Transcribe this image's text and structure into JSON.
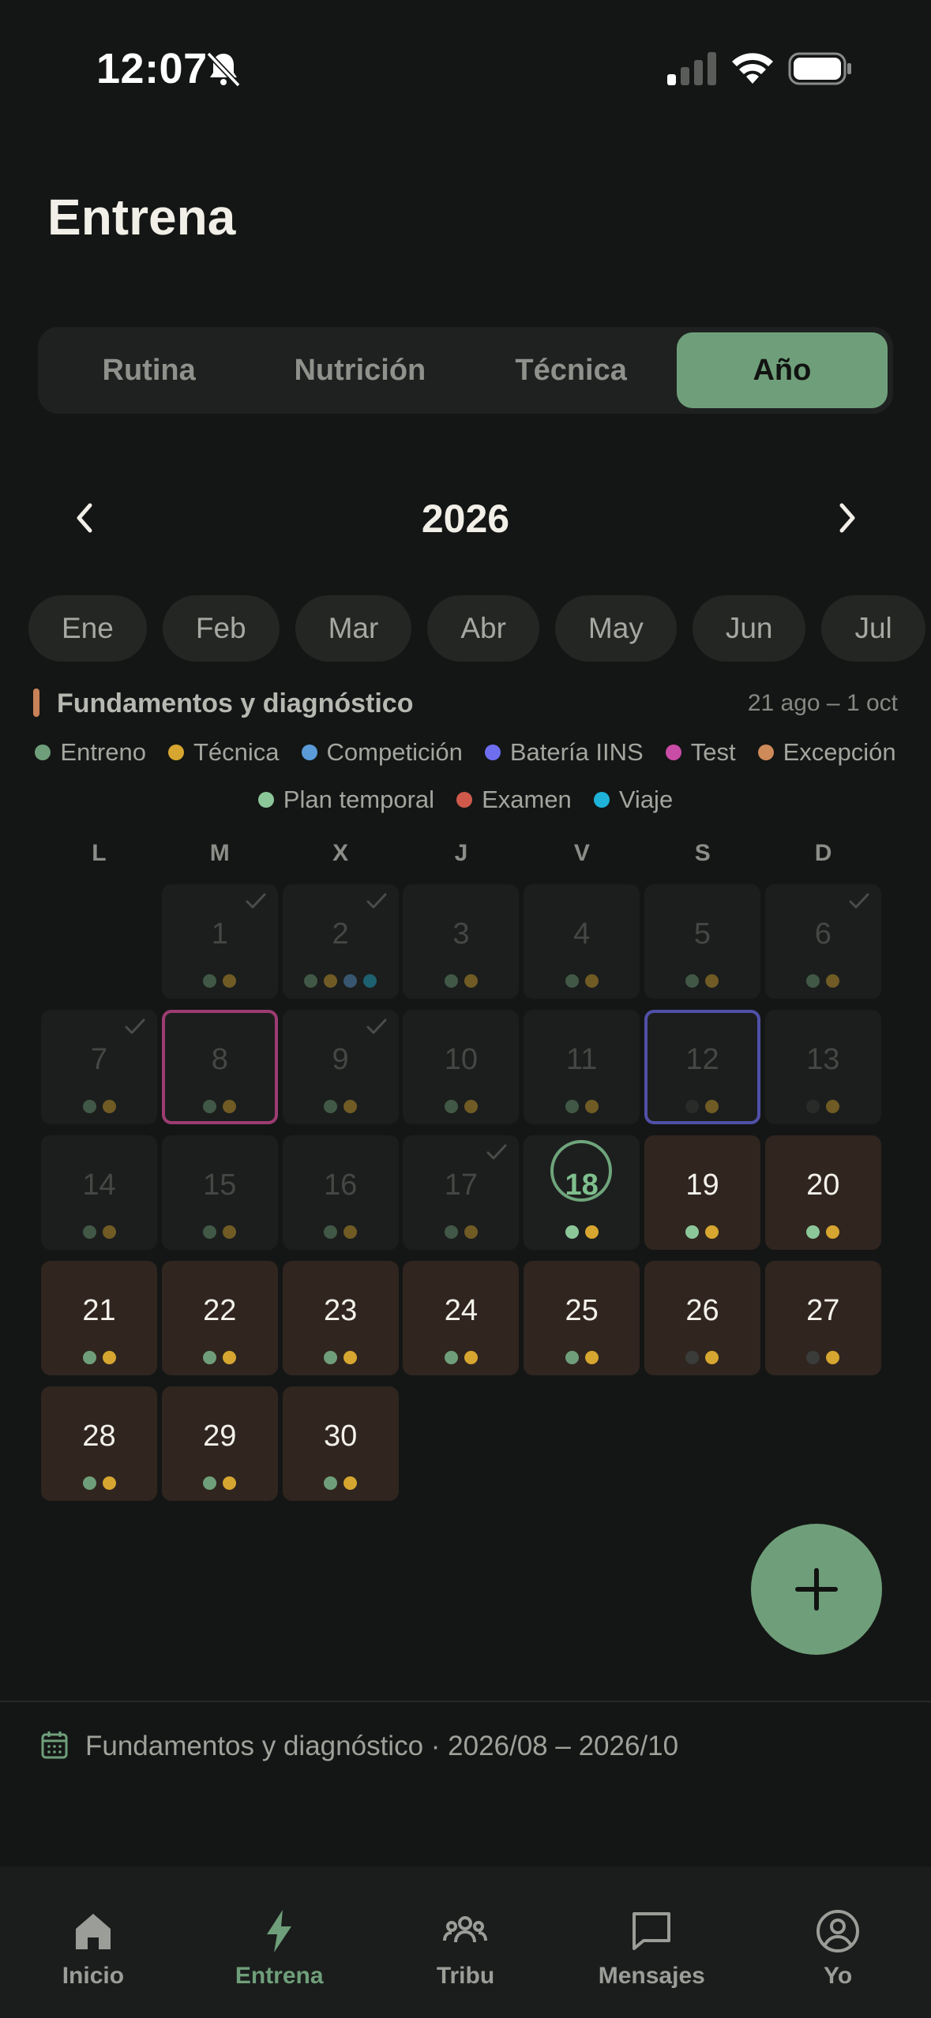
{
  "status_bar": {
    "time": "12:07"
  },
  "page_title": "Entrena",
  "tabs": [
    {
      "label": "Rutina",
      "active": false
    },
    {
      "label": "Nutrición",
      "active": false
    },
    {
      "label": "Técnica",
      "active": false
    },
    {
      "label": "Año",
      "active": true
    }
  ],
  "year_nav": {
    "year": "2026"
  },
  "months": [
    "Ene",
    "Feb",
    "Mar",
    "Abr",
    "May",
    "Jun",
    "Jul"
  ],
  "phase": {
    "name": "Fundamentos y diagnóstico",
    "dates": "21 ago – 1 oct"
  },
  "legend": [
    {
      "label": "Entreno",
      "color": "#6f9f7a"
    },
    {
      "label": "Técnica",
      "color": "#d6a630"
    },
    {
      "label": "Competición",
      "color": "#5b9bd8"
    },
    {
      "label": "Batería IINS",
      "color": "#6e6ef0"
    },
    {
      "label": "Test",
      "color": "#c94ca6"
    },
    {
      "label": "Excepción",
      "color": "#cf8a5a"
    },
    {
      "label": "Plan temporal",
      "color": "#8cc79a"
    },
    {
      "label": "Examen",
      "color": "#cf5a4c"
    },
    {
      "label": "Viaje",
      "color": "#1fb3d9"
    }
  ],
  "calendar": {
    "weekdays": [
      "L",
      "M",
      "X",
      "J",
      "V",
      "S",
      "D"
    ],
    "leading_blanks": 1,
    "days": [
      {
        "num": "1",
        "state": "past",
        "check": true,
        "dots": [
          "#6f9f7a",
          "#d6a630"
        ]
      },
      {
        "num": "2",
        "state": "past",
        "check": true,
        "dots": [
          "#6f9f7a",
          "#d6a630",
          "#5b9bd8",
          "#1fb3d9"
        ]
      },
      {
        "num": "3",
        "state": "past",
        "check": false,
        "dots": [
          "#6f9f7a",
          "#d6a630"
        ]
      },
      {
        "num": "4",
        "state": "past",
        "check": false,
        "dots": [
          "#6f9f7a",
          "#d6a630"
        ]
      },
      {
        "num": "5",
        "state": "past",
        "check": false,
        "dots": [
          "#6f9f7a",
          "#d6a630"
        ]
      },
      {
        "num": "6",
        "state": "past",
        "check": true,
        "dots": [
          "#6f9f7a",
          "#d6a630"
        ]
      },
      {
        "num": "7",
        "state": "past",
        "check": true,
        "dots": [
          "#6f9f7a",
          "#d6a630"
        ]
      },
      {
        "num": "8",
        "state": "past",
        "check": false,
        "outline": "test",
        "dots": [
          "#6f9f7a",
          "#d6a630"
        ]
      },
      {
        "num": "9",
        "state": "past",
        "check": true,
        "dots": [
          "#6f9f7a",
          "#d6a630"
        ]
      },
      {
        "num": "10",
        "state": "past",
        "check": false,
        "dots": [
          "#6f9f7a",
          "#d6a630"
        ]
      },
      {
        "num": "11",
        "state": "past",
        "check": false,
        "dots": [
          "#6f9f7a",
          "#d6a630"
        ]
      },
      {
        "num": "12",
        "state": "past",
        "check": false,
        "outline": "bateria",
        "dots": [
          "#3a3c3a",
          "#d6a630"
        ]
      },
      {
        "num": "13",
        "state": "past",
        "check": false,
        "dots": [
          "#3a3c3a",
          "#d6a630"
        ]
      },
      {
        "num": "14",
        "state": "past",
        "check": false,
        "dots": [
          "#6f9f7a",
          "#d6a630"
        ]
      },
      {
        "num": "15",
        "state": "past",
        "check": false,
        "dots": [
          "#6f9f7a",
          "#d6a630"
        ]
      },
      {
        "num": "16",
        "state": "past",
        "check": false,
        "dots": [
          "#6f9f7a",
          "#d6a630"
        ]
      },
      {
        "num": "17",
        "state": "past",
        "check": true,
        "dots": [
          "#6f9f7a",
          "#d6a630"
        ]
      },
      {
        "num": "18",
        "state": "today",
        "check": false,
        "dots": [
          "#8cc79a",
          "#d6a630"
        ]
      },
      {
        "num": "19",
        "state": "future",
        "check": false,
        "dots": [
          "#8cc79a",
          "#d6a630"
        ]
      },
      {
        "num": "20",
        "state": "future",
        "check": false,
        "dots": [
          "#8cc79a",
          "#d6a630"
        ]
      },
      {
        "num": "21",
        "state": "future",
        "check": false,
        "dots": [
          "#6f9f7a",
          "#d6a630"
        ]
      },
      {
        "num": "22",
        "state": "future",
        "check": false,
        "dots": [
          "#6f9f7a",
          "#d6a630"
        ]
      },
      {
        "num": "23",
        "state": "future",
        "check": false,
        "dots": [
          "#6f9f7a",
          "#d6a630"
        ]
      },
      {
        "num": "24",
        "state": "future",
        "check": false,
        "dots": [
          "#6f9f7a",
          "#d6a630"
        ]
      },
      {
        "num": "25",
        "state": "future",
        "check": false,
        "dots": [
          "#6f9f7a",
          "#d6a630"
        ]
      },
      {
        "num": "26",
        "state": "future",
        "check": false,
        "dots": [
          "#3a3c3a",
          "#d6a630"
        ]
      },
      {
        "num": "27",
        "state": "future",
        "check": false,
        "dots": [
          "#3a3c3a",
          "#d6a630"
        ]
      },
      {
        "num": "28",
        "state": "future",
        "check": false,
        "dots": [
          "#6f9f7a",
          "#d6a630"
        ]
      },
      {
        "num": "29",
        "state": "future",
        "check": false,
        "dots": [
          "#6f9f7a",
          "#d6a630"
        ]
      },
      {
        "num": "30",
        "state": "future",
        "check": false,
        "dots": [
          "#6f9f7a",
          "#d6a630"
        ]
      }
    ]
  },
  "info_bar": {
    "text": "Fundamentos y diagnóstico · 2026/08 – 2026/10"
  },
  "tab_bar": [
    {
      "label": "Inicio",
      "icon": "home-icon",
      "active": false
    },
    {
      "label": "Entrena",
      "icon": "bolt-icon",
      "active": true
    },
    {
      "label": "Tribu",
      "icon": "group-icon",
      "active": false
    },
    {
      "label": "Mensajes",
      "icon": "message-icon",
      "active": false
    },
    {
      "label": "Yo",
      "icon": "profile-icon",
      "active": false
    }
  ],
  "colors": {
    "accent": "#6f9f7a",
    "background": "#141615"
  }
}
